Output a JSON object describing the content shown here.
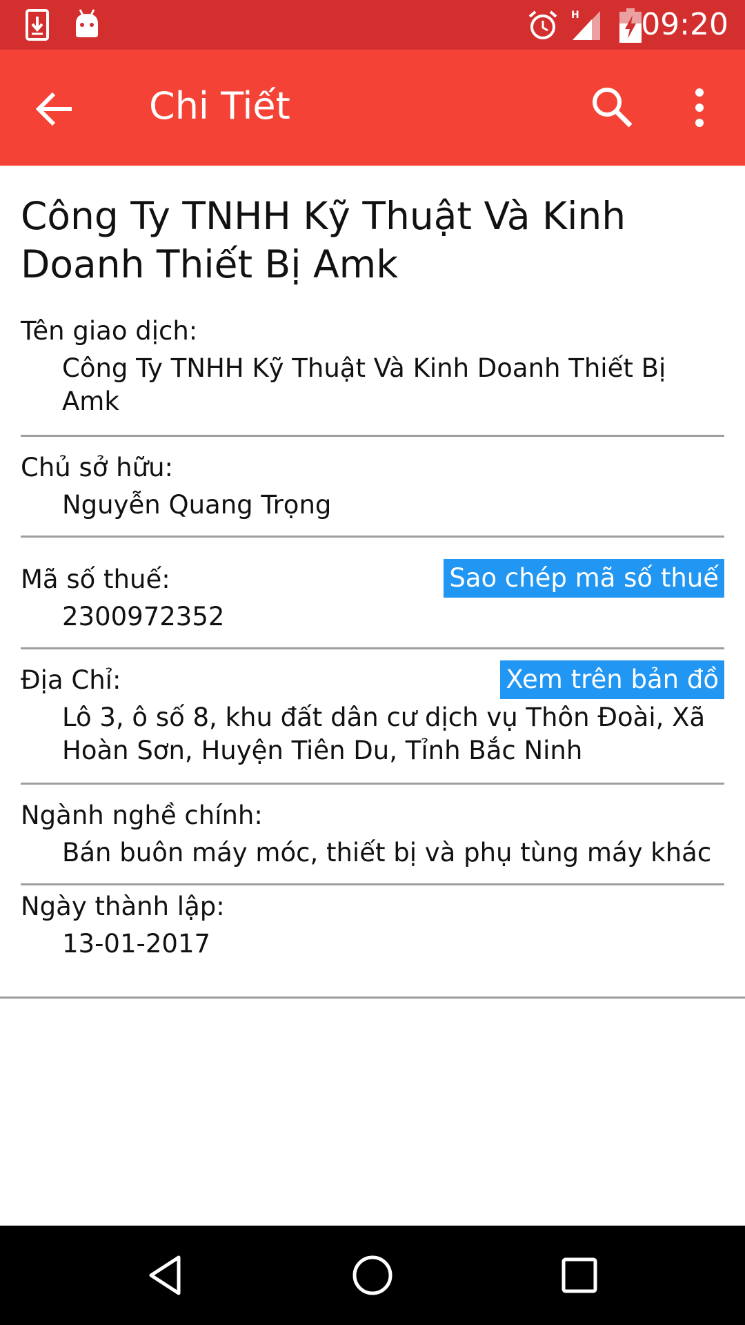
{
  "status_bar": {
    "time": "09:20",
    "icons": [
      "download-icon",
      "android-icon",
      "alarm-icon",
      "signal-h-icon",
      "battery-charging-icon"
    ]
  },
  "app_bar": {
    "title": "Chi Tiết",
    "icons": [
      "back-arrow-icon",
      "search-icon",
      "more-vert-icon"
    ]
  },
  "company": {
    "name": "Công Ty TNHH Kỹ Thuật Và Kinh Doanh Thiết Bị Amk"
  },
  "fields": {
    "trade_name": {
      "label": "Tên giao dịch:",
      "value": "Công Ty TNHH Kỹ Thuật Và Kinh Doanh Thiết Bị Amk"
    },
    "owner": {
      "label": "Chủ sở hữu:",
      "value": "Nguyễn Quang Trọng"
    },
    "tax_code": {
      "label": "Mã số thuế:",
      "value": "2300972352",
      "action": "Sao chép mã số thuế"
    },
    "address": {
      "label": "Địa Chỉ:",
      "value": "Lô 3, ô số 8, khu đất dân cư dịch vụ Thôn Đoài, Xã Hoàn Sơn, Huyện Tiên Du, Tỉnh Bắc Ninh",
      "action": "Xem trên bản đồ"
    },
    "main_business": {
      "label": "Ngành nghề chính:",
      "value": "Bán buôn máy móc, thiết bị và phụ tùng máy khác"
    },
    "founded": {
      "label": "Ngày thành lập:",
      "value": "13-01-2017"
    }
  },
  "nav_bar": {
    "icons": [
      "nav-back-icon",
      "nav-home-icon",
      "nav-recents-icon"
    ]
  },
  "colors": {
    "status_bar": "#d32f2f",
    "app_bar": "#f44336",
    "action_chip": "#2196f3",
    "divider": "#9e9e9e",
    "nav_bar": "#000000"
  }
}
